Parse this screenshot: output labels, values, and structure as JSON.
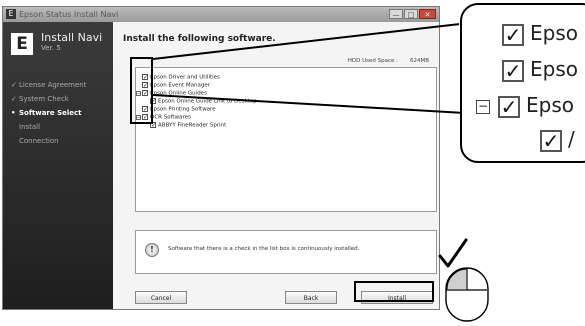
{
  "window": {
    "title": "Epson Status Install Navi",
    "minimize_glyph": "—",
    "maximize_glyph": "□",
    "close_glyph": "✕"
  },
  "sidebar": {
    "logo_letter": "E",
    "app_name": "Install Navi",
    "version": "Ver. 5",
    "steps": [
      {
        "label": "License Agreement",
        "mark": "✓",
        "state": "done"
      },
      {
        "label": "System Check",
        "mark": "✓",
        "state": "done"
      },
      {
        "label": "Software Select",
        "mark": "•",
        "state": "active"
      },
      {
        "label": "Install",
        "mark": "",
        "state": "pending"
      },
      {
        "label": "Connection",
        "mark": "",
        "state": "pending"
      }
    ]
  },
  "main": {
    "heading": "Install the following software.",
    "hdd_label": "HDD Used Space :",
    "hdd_value": "624MB",
    "software": [
      {
        "expander": "",
        "label": "Epson Driver and Utilities",
        "checked": true,
        "indent": 0
      },
      {
        "expander": "",
        "label": "Epson Event Manager",
        "checked": true,
        "indent": 0
      },
      {
        "expander": "⊟",
        "label": "Epson Online Guides",
        "checked": true,
        "indent": 0
      },
      {
        "expander": "",
        "label": "Epson Online Guide Link to Desktop",
        "checked": true,
        "indent": 1
      },
      {
        "expander": "",
        "label": "Epson Printing Software",
        "checked": true,
        "indent": 0
      },
      {
        "expander": "⊟",
        "label": "OCR Softwares",
        "checked": true,
        "indent": 0
      },
      {
        "expander": "",
        "label": "ABBYY FineReader Sprint",
        "checked": true,
        "indent": 1
      }
    ],
    "info_icon_glyph": "!",
    "info_text": "Software that there is a check in the list box is continuously installed.",
    "buttons": {
      "cancel": "Cancel",
      "back": "Back",
      "install": "Install"
    }
  },
  "callout": {
    "rows": [
      {
        "expander": "",
        "label": "Epso",
        "checked": true
      },
      {
        "expander": "",
        "label": "Epso",
        "checked": true
      },
      {
        "expander": "⊟",
        "label": "Epso",
        "checked": true
      },
      {
        "expander": "",
        "label": "/",
        "checked": true
      }
    ]
  },
  "check_glyph": "✓"
}
